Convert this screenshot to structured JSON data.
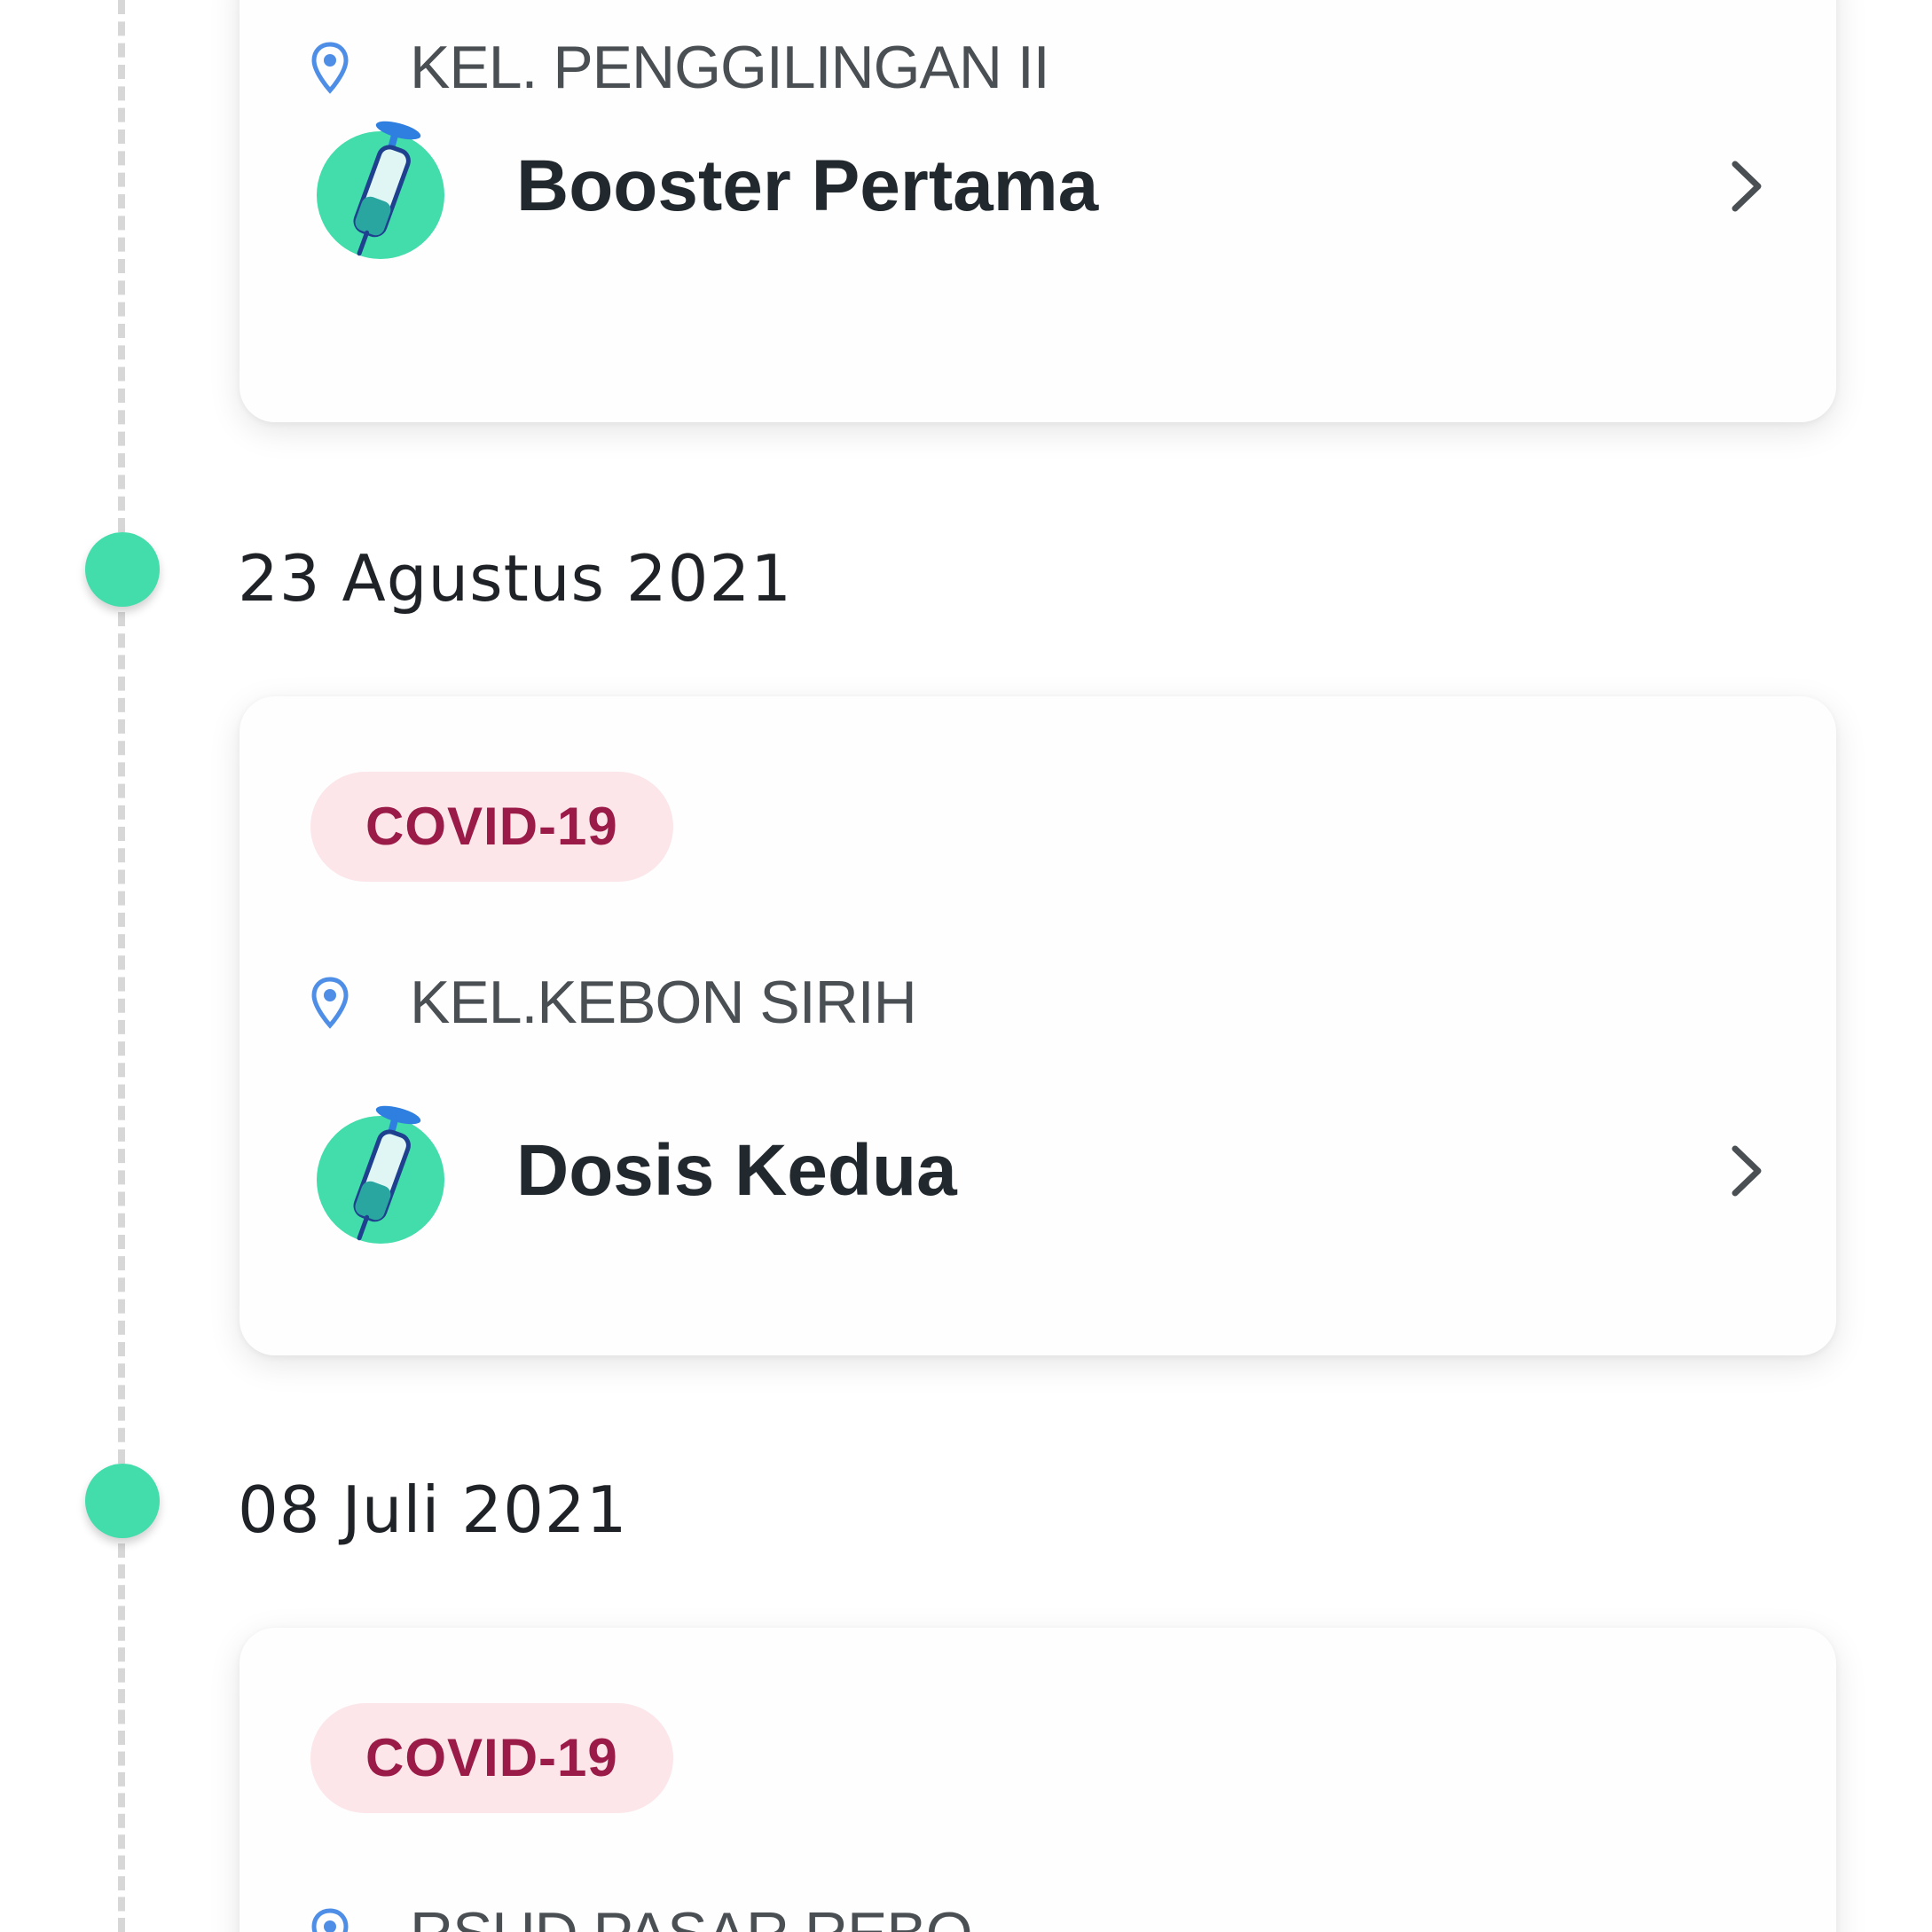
{
  "timeline": {
    "entries": [
      {
        "date": "",
        "badge": "",
        "location": "KEL. PENGGILINGAN II",
        "dose": "Booster Pertama"
      },
      {
        "date": "23 Agustus 2021",
        "badge": "COVID-19",
        "location": "KEL.KEBON SIRIH",
        "dose": "Dosis Kedua"
      },
      {
        "date": "08 Juli 2021",
        "badge": "COVID-19",
        "location": "RSUD PASAR REBO",
        "dose": ""
      }
    ]
  },
  "colors": {
    "accent": "#43dcab",
    "badge_bg": "#fce6ea",
    "badge_text": "#9b1b48",
    "location_pin": "#4f8ee6"
  },
  "icons": {
    "location": "location-pin-icon",
    "vaccine": "syringe-icon",
    "chevron": "chevron-right-icon"
  }
}
